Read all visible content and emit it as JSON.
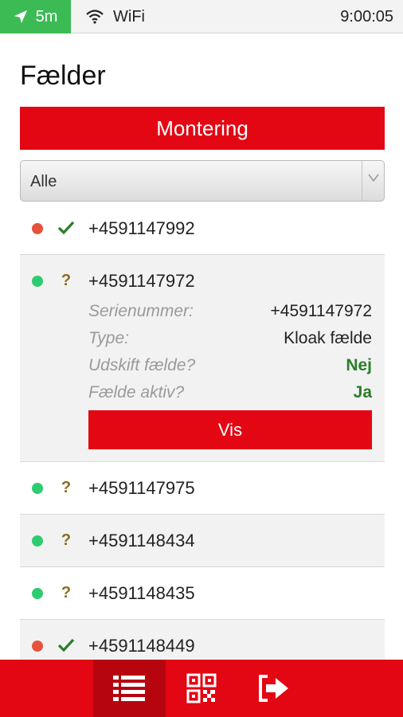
{
  "status_bar": {
    "location_label": "5m",
    "network_label": "WiFi",
    "time": "9:00:05"
  },
  "page_title": "Fælder",
  "montering_button": "Montering",
  "filter_select": {
    "selected": "Alle"
  },
  "traps": [
    {
      "status_color": "red",
      "status_mark": "check",
      "number": "+4591147992"
    },
    {
      "status_color": "green",
      "status_mark": "question",
      "number": "+4591147972",
      "expanded": true,
      "details": [
        {
          "label": "Serienummer:",
          "value": "+4591147972"
        },
        {
          "label": "Type:",
          "value": "Kloak fælde"
        },
        {
          "label": "Udskift fælde?",
          "value": "Nej"
        },
        {
          "label": "Fælde aktiv?",
          "value": "Ja"
        }
      ],
      "action_label": "Vis"
    },
    {
      "status_color": "green",
      "status_mark": "question",
      "number": "+4591147975"
    },
    {
      "status_color": "green",
      "status_mark": "question",
      "number": "+4591148434"
    },
    {
      "status_color": "green",
      "status_mark": "question",
      "number": "+4591148435"
    },
    {
      "status_color": "red",
      "status_mark": "check",
      "number": "+4591148449"
    }
  ],
  "tabbar": {
    "tabs": [
      {
        "icon": "list-icon",
        "active": true
      },
      {
        "icon": "qr-code-icon",
        "active": false
      },
      {
        "icon": "logout-icon",
        "active": false
      }
    ]
  },
  "colors": {
    "accent": "#e30613",
    "accent_dark": "#b7050f",
    "location_green": "#3cba54",
    "dot_green": "#2ecc71",
    "dot_red": "#e5533d",
    "check_green": "#2a7d2a"
  }
}
